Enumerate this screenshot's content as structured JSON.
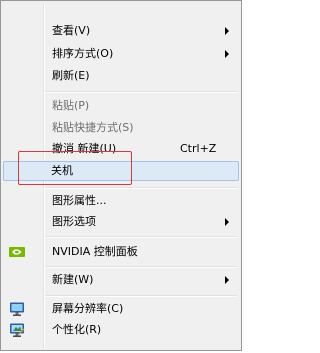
{
  "menu": {
    "items": [
      {
        "label": "查看(V)",
        "submenu": true
      },
      {
        "label": "排序方式(O)",
        "submenu": true
      },
      {
        "label": "刷新(E)"
      },
      {
        "label": "粘贴(P)",
        "disabled": true
      },
      {
        "label": "粘贴快捷方式(S)",
        "disabled": true
      },
      {
        "label": "撤消 新建(U)",
        "shortcut": "Ctrl+Z"
      },
      {
        "label": "关机",
        "highlighted": true
      },
      {
        "label": "图形属性..."
      },
      {
        "label": "图形选项",
        "submenu": true
      },
      {
        "label": "NVIDIA 控制面板",
        "icon": "nvidia-icon"
      },
      {
        "label": "新建(W)",
        "submenu": true
      },
      {
        "label": "屏幕分辨率(C)",
        "icon": "display-icon"
      },
      {
        "label": "个性化(R)",
        "icon": "personalize-icon"
      }
    ]
  },
  "colors": {
    "menu_bg": "#f0f0f0",
    "hover_bg": "#dce9f7",
    "hover_border": "#a3c3e8",
    "annotation_border": "#d9393c",
    "nvidia_green": "#76b900"
  }
}
